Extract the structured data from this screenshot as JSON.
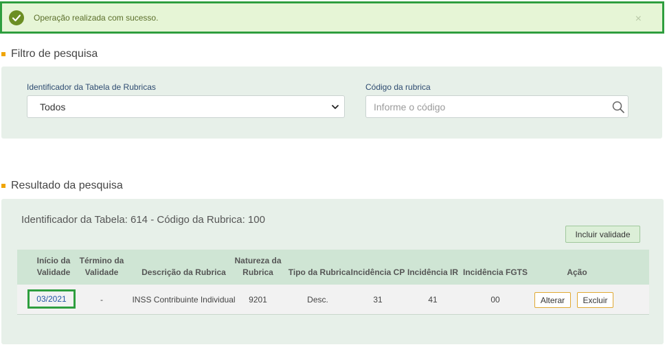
{
  "alert": {
    "message": "Operação realizada com sucesso.",
    "close": "×"
  },
  "filter": {
    "title": "Filtro de pesquisa",
    "table_id_label": "Identificador da Tabela de Rubricas",
    "table_id_value": "Todos",
    "code_label": "Código da rubrica",
    "code_placeholder": "Informe o código"
  },
  "results": {
    "title": "Resultado da pesquisa",
    "heading": "Identificador da Tabela: 614  - Código da Rubrica: 100",
    "add_validity_button": "Incluir validade",
    "columns": {
      "start": [
        "Início da",
        "Validade"
      ],
      "end": [
        "Término da",
        "Validade"
      ],
      "description": "Descrição da Rubrica",
      "nature": [
        "Natureza da",
        "Rubrica"
      ],
      "type": "Tipo da Rubrica",
      "cp": "Incidência CP",
      "ir": "Incidência IR",
      "fgts": "Incidência FGTS",
      "action": "Ação"
    },
    "row": {
      "start": "03/2021",
      "end": "-",
      "description": "INSS Contribuinte Individual",
      "nature": "9201",
      "type": "Desc.",
      "cp": "31",
      "ir": "41",
      "fgts": "00",
      "edit": "Alterar",
      "delete": "Excluir"
    }
  }
}
